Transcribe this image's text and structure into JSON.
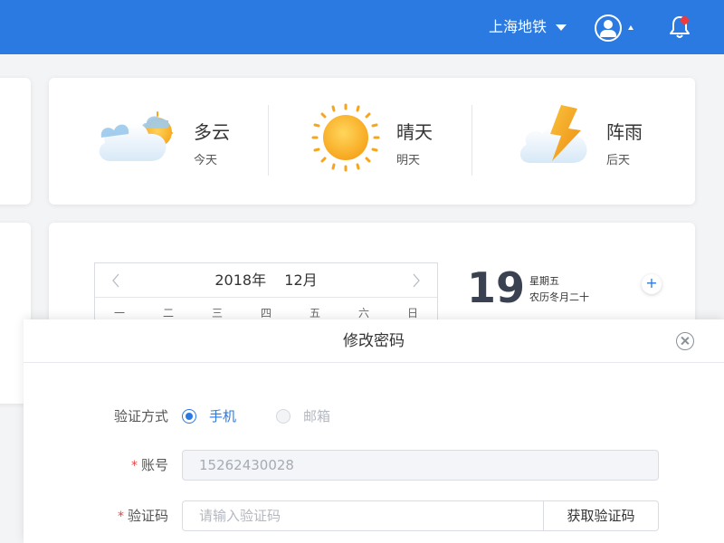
{
  "header": {
    "city": "上海地铁",
    "user_icon": "user-circle-icon",
    "bell_icon": "bell-icon",
    "colors": {
      "bar": "#2a7ae2",
      "badge": "#f03a3a"
    }
  },
  "weather": [
    {
      "name": "多云",
      "day": "今天",
      "icon": "cloudy-icon"
    },
    {
      "name": "晴天",
      "day": "明天",
      "icon": "sunny-icon"
    },
    {
      "name": "阵雨",
      "day": "后天",
      "icon": "thunder-shower-icon"
    }
  ],
  "calendar": {
    "year_label": "2018年",
    "month_label": "12月",
    "weekdays": [
      "一",
      "二",
      "三",
      "四",
      "五",
      "六",
      "日"
    ],
    "day": "19",
    "weekday": "星期五",
    "lunar": "农历冬月二十",
    "add_label": "+"
  },
  "modal": {
    "title": "修改密码",
    "verify_method_label": "验证方式",
    "options": [
      {
        "label": "手机",
        "checked": true
      },
      {
        "label": "邮箱",
        "checked": false
      }
    ],
    "account": {
      "required_mark": "*",
      "label": "账号",
      "value": "15262430028"
    },
    "code": {
      "required_mark": "*",
      "label": "验证码",
      "placeholder": "请输入验证码",
      "button": "获取验证码"
    }
  }
}
